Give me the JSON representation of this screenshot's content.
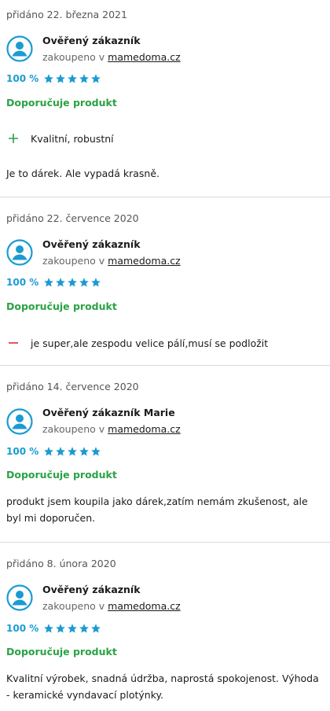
{
  "colors": {
    "accent": "#1b9bd1",
    "recommend": "#2aa244",
    "minus": "#e04444",
    "divider": "#d9d9d9"
  },
  "reviews": [
    {
      "date": "přidáno 22. března 2021",
      "author": "Ověřený zákazník",
      "purchased_prefix": "zakoupeno v",
      "shop": "mamedoma.cz",
      "rating_pct": "100 %",
      "stars": 5,
      "recommend": "Doporučuje produkt",
      "pro": "Kvalitní, robustní",
      "text": "Je to dárek. Ale vypadá krasně."
    },
    {
      "date": "přidáno 22. července 2020",
      "author": "Ověřený zákazník",
      "purchased_prefix": "zakoupeno v",
      "shop": "mamedoma.cz",
      "rating_pct": "100 %",
      "stars": 5,
      "recommend": "Doporučuje produkt",
      "con": "je super,ale zespodu velice pálí,musí se podložit"
    },
    {
      "date": "přidáno 14. července 2020",
      "author": "Ověřený zákazník Marie",
      "purchased_prefix": "zakoupeno v",
      "shop": "mamedoma.cz",
      "rating_pct": "100 %",
      "stars": 5,
      "recommend": "Doporučuje produkt",
      "text": "produkt jsem koupila jako dárek,zatím nemám zkušenost, ale byl mi doporučen."
    },
    {
      "date": "přidáno 8. února 2020",
      "author": "Ověřený zákazník",
      "purchased_prefix": "zakoupeno v",
      "shop": "mamedoma.cz",
      "rating_pct": "100 %",
      "stars": 5,
      "recommend": "Doporučuje produkt",
      "text": "Kvalitní výrobek, snadná údržba, naprostá spokojenost. Výhoda - keramické vyndavací plotýnky."
    }
  ]
}
